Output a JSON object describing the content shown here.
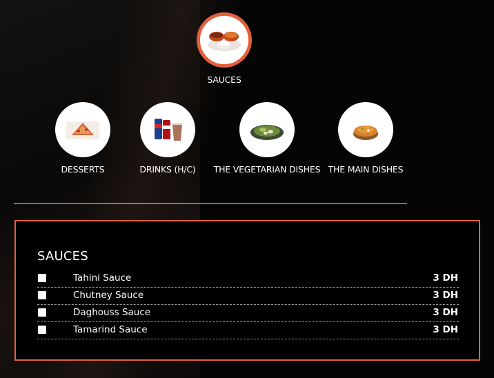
{
  "featured_category": {
    "label": "SAUCES",
    "icon": "sauce-bowls-icon"
  },
  "categories": [
    {
      "label": "DESSERTS",
      "icon": "dessert-plate-icon"
    },
    {
      "label": "DRINKS (H/C)",
      "icon": "drinks-icon"
    },
    {
      "label": "THE VEGETARIAN DISHES",
      "icon": "vegetarian-dish-icon"
    },
    {
      "label": "THE MAIN DISHES",
      "icon": "main-dish-icon"
    }
  ],
  "panel": {
    "title": "SAUCES",
    "items": [
      {
        "name": "Tahini Sauce",
        "price": "3 DH",
        "checked": false
      },
      {
        "name": "Chutney Sauce",
        "price": "3 DH",
        "checked": false
      },
      {
        "name": "Daghouss Sauce",
        "price": "3 DH",
        "checked": false
      },
      {
        "name": "Tamarind Sauce",
        "price": "3 DH",
        "checked": false
      }
    ]
  },
  "colors": {
    "accent": "#e35f3c",
    "background": "#050505",
    "text": "#ffffff"
  }
}
